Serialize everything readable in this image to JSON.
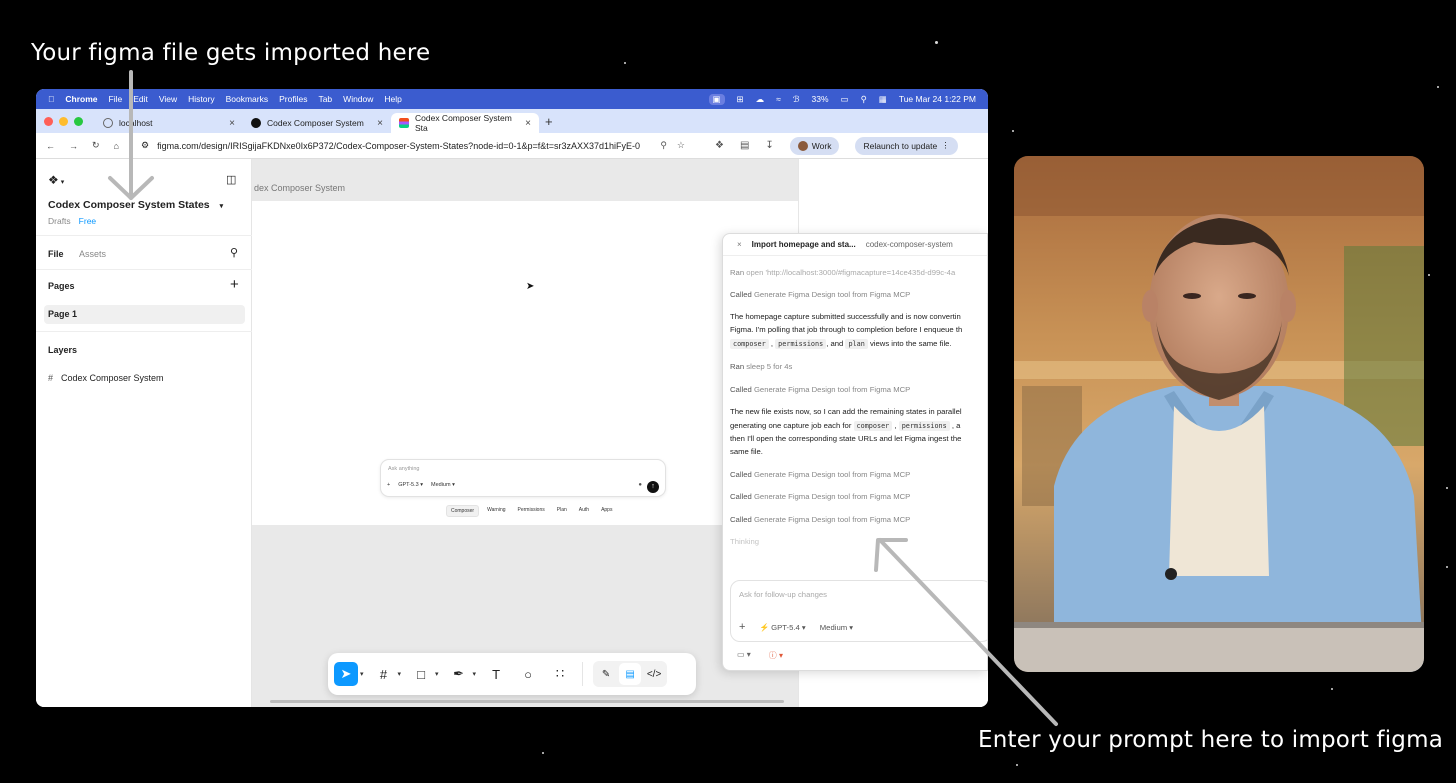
{
  "captions": {
    "top": "Your figma file gets imported here",
    "bottom": "Enter your prompt here to import figma"
  },
  "menubar": {
    "app": "Chrome",
    "items": [
      "File",
      "Edit",
      "View",
      "History",
      "Bookmarks",
      "Profiles",
      "Tab",
      "Window",
      "Help"
    ],
    "battery": "33%",
    "datetime": "Tue Mar 24  1:22 PM"
  },
  "tabs": [
    {
      "title": "localhost"
    },
    {
      "title": "Codex Composer System"
    },
    {
      "title": "Codex Composer System Sta"
    }
  ],
  "url": "figma.com/design/IRISgijaFKDNxe0Ix6P372/Codex-Composer-System-States?node-id=0-1&p=f&t=sr3zAXX37d1hiFyE-0",
  "profile": {
    "label": "Work"
  },
  "relaunch": "Relaunch to update",
  "figma": {
    "file_title": "Codex Composer System States",
    "drafts": "Drafts",
    "plan": "Free",
    "tab_file": "File",
    "tab_assets": "Assets",
    "pages_heading": "Pages",
    "page1": "Page 1",
    "layers_heading": "Layers",
    "layer1": "Codex Composer System",
    "frame_label": "dex Composer System"
  },
  "composer": {
    "placeholder": "Ask anything",
    "model": "GPT-5.3",
    "effort": "Medium",
    "chips": [
      "Composer",
      "Warning",
      "Permissions",
      "Plan",
      "Auth",
      "Apps"
    ]
  },
  "panel": {
    "title": "Import homepage and sta...",
    "subtitle": "codex-composer-system",
    "ran1_verb": "Ran",
    "ran1_cmd": "open 'http://localhost:3000/#figmacapture=14ce435d-d99c-4a",
    "called_verb": "Called",
    "called_text": "Generate Figma Design tool from Figma MCP",
    "para1_line1": "The homepage capture submitted successfully and is now convertin",
    "para1_line2": "Figma. I'm polling that job through to completion before I enqueue th",
    "para1_code1": "composer",
    "para1_code2": "permissions",
    "para1_mid": ", and",
    "para1_code3": "plan",
    "para1_end": "views into the same file.",
    "ran2_verb": "Ran",
    "ran2_cmd": "sleep 5 for 4s",
    "para2_line1": "The new file exists now, so I can add the remaining states in parallel",
    "para2_line2_a": "generating one capture job each for",
    "para2_code1": "composer",
    "para2_code2": "permissions",
    "para2_line2_b": ", a",
    "para2_line3": "then I'll open the corresponding state URLs and let Figma ingest the",
    "para2_line4": "same file.",
    "thinking": "Thinking",
    "followup_placeholder": "Ask for follow-up changes",
    "model": "GPT-5.4",
    "effort": "Medium"
  },
  "colors": {
    "menubar": "#3b5ccf",
    "tabbar": "#d8e3fb",
    "figma_blue": "#0d99ff",
    "canvas": "#e9e9e9"
  },
  "icons": [
    "apple-icon",
    "figma-logo-icon",
    "sidebar-toggle-icon",
    "search-icon",
    "plus-icon",
    "frame-icon",
    "move-tool-icon",
    "frame-tool-icon",
    "shape-tool-icon",
    "pen-tool-icon",
    "text-tool-icon",
    "comment-tool-icon",
    "actions-icon",
    "help-icon",
    "close-icon",
    "arrow-icon"
  ]
}
